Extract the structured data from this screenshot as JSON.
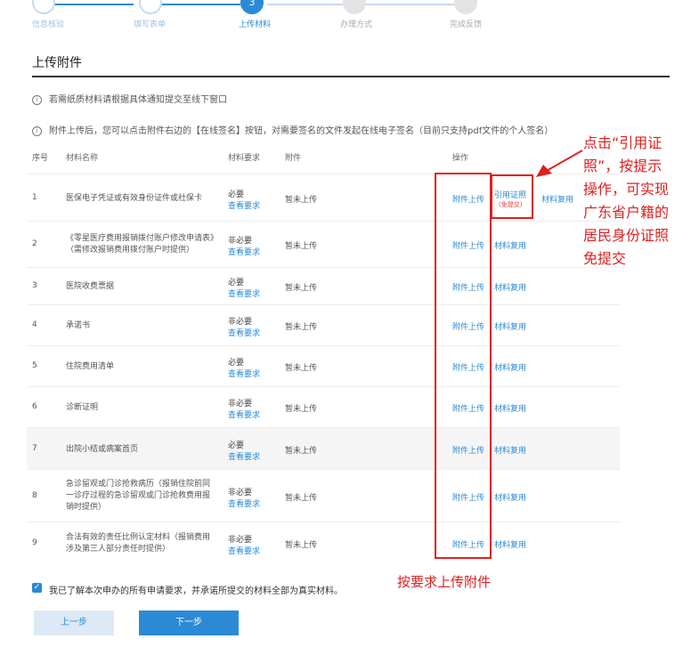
{
  "steps": [
    {
      "label": "信息核验",
      "num": "1"
    },
    {
      "label": "填写表单",
      "num": "2"
    },
    {
      "label": "上传材料",
      "num": "3"
    },
    {
      "label": "办理方式",
      "num": "4"
    },
    {
      "label": "完成反馈",
      "num": "5"
    }
  ],
  "section_title": "上传附件",
  "notices": [
    "若需纸质材料请根据具体通知提交至线下窗口",
    "附件上传后，您可以点击附件右边的【在线签名】按钮，对需要签名的文件发起在线电子签名（目前只支持pdf文件的个人签名）"
  ],
  "table": {
    "headers": {
      "no": "序号",
      "name": "材料名称",
      "req": "材料要求",
      "att": "附件",
      "op": "操作"
    },
    "view_req_label": "查看要求",
    "rows": [
      {
        "no": "1",
        "name": "医保电子凭证或有效身份证件或社保卡",
        "req": "必要",
        "att": "暂未上传",
        "ops": [
          "附件上传",
          "引用证照",
          "材料复用"
        ],
        "sub": "(免提交)"
      },
      {
        "no": "2",
        "name": "《零星医疗费用报销拨付账户修改申请表》（需修改报销费用拨付账户时提供）",
        "req": "非必要",
        "att": "暂未上传",
        "ops": [
          "附件上传",
          "材料复用"
        ]
      },
      {
        "no": "3",
        "name": "医院收费票据",
        "req": "必要",
        "att": "暂未上传",
        "ops": [
          "附件上传",
          "材料复用"
        ]
      },
      {
        "no": "4",
        "name": "承诺书",
        "req": "非必要",
        "att": "暂未上传",
        "ops": [
          "附件上传",
          "材料复用"
        ]
      },
      {
        "no": "5",
        "name": "住院费用清单",
        "req": "必要",
        "att": "暂未上传",
        "ops": [
          "附件上传",
          "材料复用"
        ]
      },
      {
        "no": "6",
        "name": "诊断证明",
        "req": "非必要",
        "att": "暂未上传",
        "ops": [
          "附件上传",
          "材料复用"
        ]
      },
      {
        "no": "7",
        "name": "出院小结或病案首页",
        "req": "必要",
        "att": "暂未上传",
        "ops": [
          "附件上传",
          "材料复用"
        ]
      },
      {
        "no": "8",
        "name": "急诊留观或门诊抢救病历（报销住院前同一诊疗过程的急诊留观或门诊抢救费用报销时提供）",
        "req": "非必要",
        "att": "暂未上传",
        "ops": [
          "附件上传",
          "材料复用"
        ]
      },
      {
        "no": "9",
        "name": "合法有效的责任比例认定材料（报销费用涉及第三人部分责任时提供）",
        "req": "非必要",
        "att": "暂未上传",
        "ops": [
          "附件上传",
          "材料复用"
        ]
      }
    ]
  },
  "annotations": {
    "right": "点击“引用证照”，按提示操作，可实现广东省户籍的居民身份证照免提交",
    "bottom": "按要求上传附件"
  },
  "agreement": "我已了解本次申办的所有申请要求，并承诺所提交的材料全部为真实材料。",
  "buttons": {
    "prev": "上一步",
    "next": "下一步"
  },
  "colors": {
    "accent": "#2b8ad6",
    "annotation": "#e02020"
  }
}
